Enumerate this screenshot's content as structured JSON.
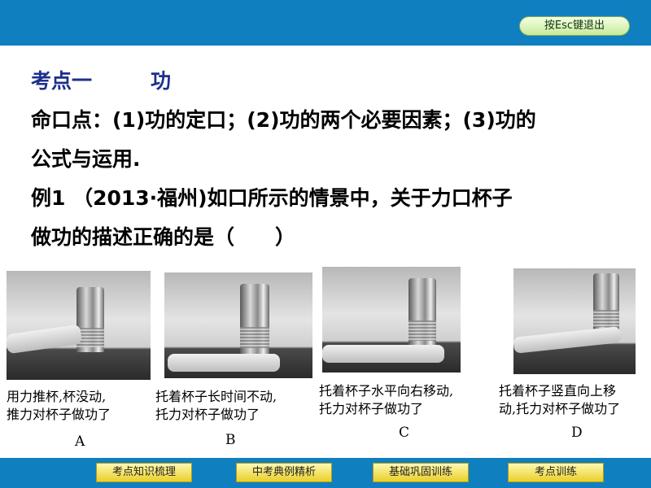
{
  "header": {
    "esc_label": "按Esc键退出"
  },
  "content": {
    "title_a": "考点一",
    "title_b": "功",
    "lines": [
      "命口点：(1)功的定口；(2)功的两个必要因素；(3)功的",
      "公式与运用.",
      "例1 （2013·福州)如口所示的情景中，关于力口杯子",
      "做功的描述正确的是（　　）"
    ]
  },
  "options": [
    {
      "caption": [
        "用力推杯,杯没动,",
        "推力对杯子做功了"
      ],
      "letter": "A"
    },
    {
      "caption": [
        "托着杯子长时间不动,",
        "托力对杯子做功了"
      ],
      "letter": "B"
    },
    {
      "caption": [
        "托着杯子水平向右移动,",
        "托力对杯子做功了"
      ],
      "letter": "C"
    },
    {
      "caption": [
        "托着杯子竖直向上移",
        "动,托力对杯子做功了"
      ],
      "letter": "D"
    }
  ],
  "nav": [
    "考点知识梳理",
    "中考典例精析",
    "基础巩固训练",
    "考点训练"
  ]
}
